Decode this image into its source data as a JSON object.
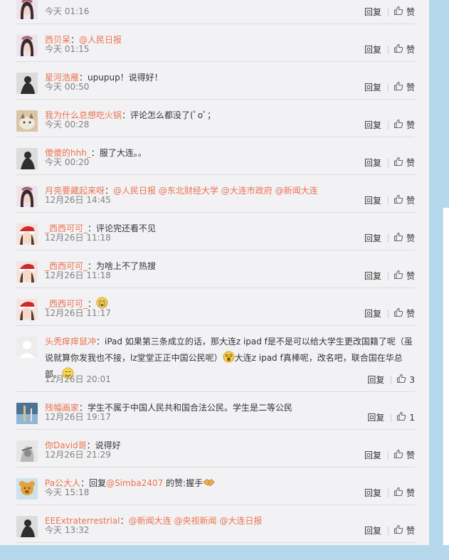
{
  "comments": [
    {
      "user": "",
      "text": [],
      "time": "今天 01:16",
      "reply": "回复",
      "like": "赞",
      "avatar": "girl-avatar"
    },
    {
      "user": "西贝呆",
      "text": [
        {
          "t": "："
        },
        {
          "m": "@人民日报"
        }
      ],
      "time": "今天 01:15",
      "reply": "回复",
      "like": "赞",
      "avatar": "girl-avatar"
    },
    {
      "user": "星河浩雁",
      "text": [
        {
          "t": "：upupup！说得好！"
        }
      ],
      "time": "今天 00:50",
      "reply": "回复",
      "like": "赞",
      "avatar": "dark-figure-avatar"
    },
    {
      "user": "我为什么总想吃火锅",
      "text": [
        {
          "t": "：评论怎么都没了(ﾟoﾟ；"
        }
      ],
      "time": "今天 00:28",
      "reply": "回复",
      "like": "赞",
      "avatar": "cat-avatar"
    },
    {
      "user": "傻傻的hhh_",
      "text": [
        {
          "t": "：服了大连。。"
        }
      ],
      "time": "今天 00:20",
      "reply": "回复",
      "like": "赞",
      "avatar": "dark-figure-avatar"
    },
    {
      "user": "月亮要藏起来呀",
      "text": [
        {
          "t": "："
        },
        {
          "m": "@人民日报"
        },
        {
          "t": " "
        },
        {
          "m": "@东北财经大学"
        },
        {
          "t": " "
        },
        {
          "m": "@大连市政府"
        },
        {
          "t": " "
        },
        {
          "m": "@新闻大连"
        }
      ],
      "time": "12月26日 14:45",
      "reply": "回复",
      "like": "赞",
      "avatar": "girl-avatar"
    },
    {
      "user": "_西西可可_",
      "text": [
        {
          "t": "：评论完还看不见"
        }
      ],
      "time": "12月26日 11:18",
      "reply": "回复",
      "like": "赞",
      "avatar": "santa-girl-avatar"
    },
    {
      "user": "_西西可可_",
      "text": [
        {
          "t": "：为啥上不了热搜"
        }
      ],
      "time": "12月26日 11:18",
      "reply": "回复",
      "like": "赞",
      "avatar": "santa-girl-avatar"
    },
    {
      "user": "_西西可可_",
      "text": [
        {
          "t": "："
        },
        {
          "e": "crying-emoji"
        }
      ],
      "time": "12月26日 11:17",
      "reply": "回复",
      "like": "赞",
      "avatar": "santa-girl-avatar"
    },
    {
      "user": "头秃痒痒鼠冲",
      "text": [
        {
          "t": "：iPad 如果第三条成立的话，那大连z ipad f是不是可以给大学生更改国籍了呢（虽说就算你发我也不接，lz堂堂正正中国公民呢）"
        },
        {
          "e": "shocked-emoji"
        },
        {
          "t": "大连z ipad f真棒呢，改名吧，联合国在华总部。"
        },
        {
          "e": "smile-emoji"
        }
      ],
      "time": "12月26日 20:01",
      "reply": "回复",
      "like": "3",
      "avatar": "default-avatar"
    },
    {
      "user": "残幅画家",
      "text": [
        {
          "t": "：学生不属于中国人民共和国合法公民。学生是二等公民"
        }
      ],
      "time": "12月26日 19:17",
      "reply": "回复",
      "like": "1",
      "avatar": "landscape-avatar"
    },
    {
      "user": "你David哥",
      "text": [
        {
          "t": "：说得好"
        }
      ],
      "time": "12月26日 21:29",
      "reply": "回复",
      "like": "赞",
      "avatar": "sketch-avatar"
    },
    {
      "user": "Pa公大人",
      "text": [
        {
          "t": "：回复"
        },
        {
          "m": "@Simba2407"
        },
        {
          "t": " 的赞:握手"
        },
        {
          "e": "handshake-emoji"
        }
      ],
      "time": "今天 15:18",
      "reply": "回复",
      "like": "赞",
      "avatar": "bear-avatar"
    },
    {
      "user": "EEExtraterrestrial",
      "text": [
        {
          "t": "："
        },
        {
          "m": "@新闻大连"
        },
        {
          "t": " "
        },
        {
          "m": "@央视新闻"
        },
        {
          "t": " "
        },
        {
          "m": "@大连日报"
        }
      ],
      "time": "今天 13:32",
      "reply": "回复",
      "like": "赞",
      "avatar": "dark-figure-avatar"
    }
  ]
}
